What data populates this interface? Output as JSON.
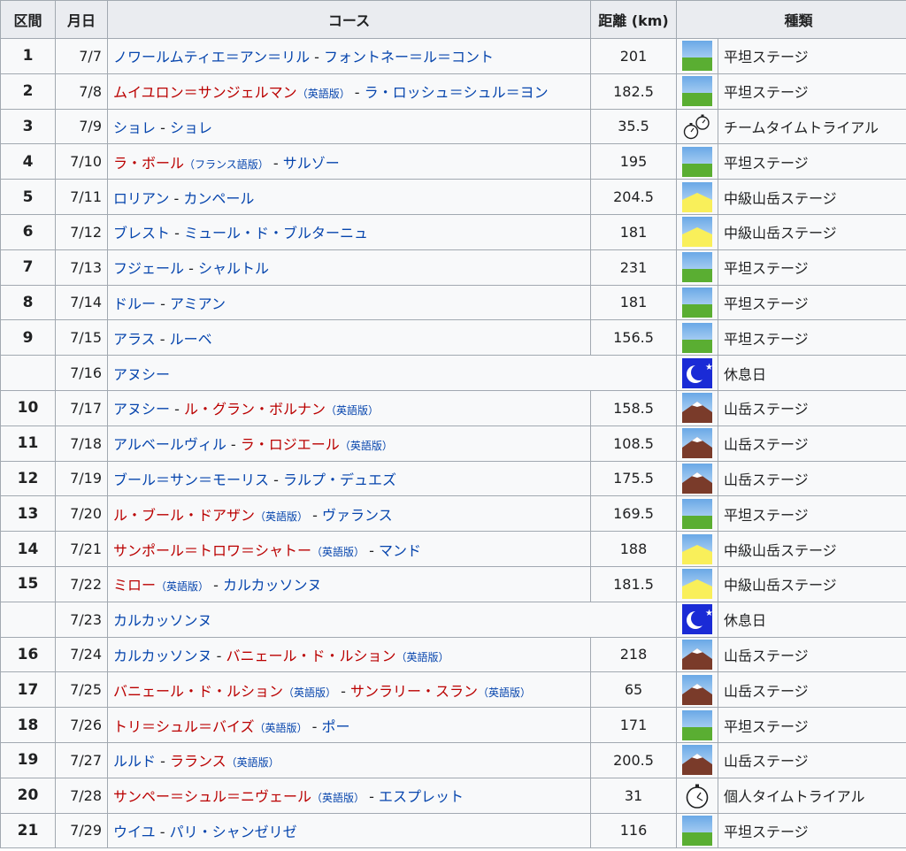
{
  "headers": [
    "区間",
    "月日",
    "コース",
    "距離 (km)",
    "種類"
  ],
  "rows": [
    {
      "stage": "1",
      "date": "7/7",
      "course": [
        {
          "t": "ノワールムティエ＝アン＝リル",
          "c": "blue"
        },
        {
          "t": " - ",
          "c": "sep"
        },
        {
          "t": "フォントネー＝ル＝コント",
          "c": "blue"
        }
      ],
      "dist": "201",
      "icon": "flat-stage-icon",
      "type": "平坦ステージ"
    },
    {
      "stage": "2",
      "date": "7/8",
      "course": [
        {
          "t": "ムイユロン＝サンジェルマン",
          "c": "red"
        },
        {
          "t": "（英語版）",
          "c": "small"
        },
        {
          "t": " - ",
          "c": "sep"
        },
        {
          "t": "ラ・ロッシュ＝シュル＝ヨン",
          "c": "blue"
        }
      ],
      "dist": "182.5",
      "icon": "flat-stage-icon",
      "type": "平坦ステージ"
    },
    {
      "stage": "3",
      "date": "7/9",
      "course": [
        {
          "t": "ショレ",
          "c": "blue"
        },
        {
          "t": " - ",
          "c": "sep"
        },
        {
          "t": "ショレ",
          "c": "blue"
        }
      ],
      "dist": "35.5",
      "icon": "team-time-trial-icon",
      "type": "チームタイムトライアル"
    },
    {
      "stage": "4",
      "date": "7/10",
      "course": [
        {
          "t": "ラ・ボール",
          "c": "red"
        },
        {
          "t": "（フランス語版）",
          "c": "small"
        },
        {
          "t": " - ",
          "c": "sep"
        },
        {
          "t": "サルゾー",
          "c": "blue"
        }
      ],
      "dist": "195",
      "icon": "flat-stage-icon",
      "type": "平坦ステージ"
    },
    {
      "stage": "5",
      "date": "7/11",
      "course": [
        {
          "t": "ロリアン",
          "c": "blue"
        },
        {
          "t": " - ",
          "c": "sep"
        },
        {
          "t": "カンペール",
          "c": "blue"
        }
      ],
      "dist": "204.5",
      "icon": "hilly-stage-icon",
      "type": "中級山岳ステージ"
    },
    {
      "stage": "6",
      "date": "7/12",
      "course": [
        {
          "t": "ブレスト",
          "c": "blue"
        },
        {
          "t": " - ",
          "c": "sep"
        },
        {
          "t": "ミュール・ド・ブルターニュ",
          "c": "blue"
        }
      ],
      "dist": "181",
      "icon": "hilly-stage-icon",
      "type": "中級山岳ステージ"
    },
    {
      "stage": "7",
      "date": "7/13",
      "course": [
        {
          "t": "フジェール",
          "c": "blue"
        },
        {
          "t": " - ",
          "c": "sep"
        },
        {
          "t": "シャルトル",
          "c": "blue"
        }
      ],
      "dist": "231",
      "icon": "flat-stage-icon",
      "type": "平坦ステージ"
    },
    {
      "stage": "8",
      "date": "7/14",
      "course": [
        {
          "t": "ドルー",
          "c": "blue"
        },
        {
          "t": " - ",
          "c": "sep"
        },
        {
          "t": "アミアン",
          "c": "blue"
        }
      ],
      "dist": "181",
      "icon": "flat-stage-icon",
      "type": "平坦ステージ"
    },
    {
      "stage": "9",
      "date": "7/15",
      "course": [
        {
          "t": "アラス",
          "c": "blue"
        },
        {
          "t": " - ",
          "c": "sep"
        },
        {
          "t": "ルーベ",
          "c": "blue"
        }
      ],
      "dist": "156.5",
      "icon": "flat-stage-icon",
      "type": "平坦ステージ"
    },
    {
      "stage": "",
      "date": "7/16",
      "course": [
        {
          "t": "アヌシー",
          "c": "blue"
        }
      ],
      "dist": null,
      "icon": "rest-day-icon",
      "type": "休息日"
    },
    {
      "stage": "10",
      "date": "7/17",
      "course": [
        {
          "t": "アヌシー",
          "c": "blue"
        },
        {
          "t": " - ",
          "c": "sep"
        },
        {
          "t": "ル・グラン・ボルナン",
          "c": "red"
        },
        {
          "t": "（英語版）",
          "c": "small"
        }
      ],
      "dist": "158.5",
      "icon": "mountain-stage-icon",
      "type": "山岳ステージ"
    },
    {
      "stage": "11",
      "date": "7/18",
      "course": [
        {
          "t": "アルベールヴィル",
          "c": "blue"
        },
        {
          "t": " - ",
          "c": "sep"
        },
        {
          "t": "ラ・ロジエール",
          "c": "red"
        },
        {
          "t": "（英語版）",
          "c": "small"
        }
      ],
      "dist": "108.5",
      "icon": "mountain-stage-icon",
      "type": "山岳ステージ"
    },
    {
      "stage": "12",
      "date": "7/19",
      "course": [
        {
          "t": "ブール＝サン＝モーリス",
          "c": "blue"
        },
        {
          "t": " - ",
          "c": "sep"
        },
        {
          "t": "ラルプ・デュエズ",
          "c": "blue"
        }
      ],
      "dist": "175.5",
      "icon": "mountain-stage-icon",
      "type": "山岳ステージ"
    },
    {
      "stage": "13",
      "date": "7/20",
      "course": [
        {
          "t": "ル・ブール・ドアザン",
          "c": "red"
        },
        {
          "t": "（英語版）",
          "c": "small"
        },
        {
          "t": " - ",
          "c": "sep"
        },
        {
          "t": "ヴァランス",
          "c": "blue"
        }
      ],
      "dist": "169.5",
      "icon": "flat-stage-icon",
      "type": "平坦ステージ"
    },
    {
      "stage": "14",
      "date": "7/21",
      "course": [
        {
          "t": "サンポール＝トロワ＝シャトー",
          "c": "red"
        },
        {
          "t": "（英語版）",
          "c": "small"
        },
        {
          "t": " - ",
          "c": "sep"
        },
        {
          "t": "マンド",
          "c": "blue"
        }
      ],
      "dist": "188",
      "icon": "hilly-stage-icon",
      "type": "中級山岳ステージ"
    },
    {
      "stage": "15",
      "date": "7/22",
      "course": [
        {
          "t": "ミロー",
          "c": "red"
        },
        {
          "t": "（英語版）",
          "c": "small"
        },
        {
          "t": " - ",
          "c": "sep"
        },
        {
          "t": "カルカッソンヌ",
          "c": "blue"
        }
      ],
      "dist": "181.5",
      "icon": "hilly-stage-icon",
      "type": "中級山岳ステージ"
    },
    {
      "stage": "",
      "date": "7/23",
      "course": [
        {
          "t": "カルカッソンヌ",
          "c": "blue"
        }
      ],
      "dist": null,
      "icon": "rest-day-icon",
      "type": "休息日"
    },
    {
      "stage": "16",
      "date": "7/24",
      "course": [
        {
          "t": "カルカッソンヌ",
          "c": "blue"
        },
        {
          "t": " - ",
          "c": "sep"
        },
        {
          "t": "バニェール・ド・ルション",
          "c": "red"
        },
        {
          "t": "（英語版）",
          "c": "small"
        }
      ],
      "dist": "218",
      "icon": "mountain-stage-icon",
      "type": "山岳ステージ"
    },
    {
      "stage": "17",
      "date": "7/25",
      "course": [
        {
          "t": "バニェール・ド・ルション",
          "c": "red"
        },
        {
          "t": "（英語版）",
          "c": "small"
        },
        {
          "t": " - ",
          "c": "sep"
        },
        {
          "t": "サンラリー・スラン",
          "c": "red"
        },
        {
          "t": "（英語版）",
          "c": "small"
        }
      ],
      "dist": "65",
      "icon": "mountain-stage-icon",
      "type": "山岳ステージ"
    },
    {
      "stage": "18",
      "date": "7/26",
      "course": [
        {
          "t": "トリ＝シュル＝バイズ",
          "c": "red"
        },
        {
          "t": "（英語版）",
          "c": "small"
        },
        {
          "t": " - ",
          "c": "sep"
        },
        {
          "t": "ポー",
          "c": "blue"
        }
      ],
      "dist": "171",
      "icon": "flat-stage-icon",
      "type": "平坦ステージ"
    },
    {
      "stage": "19",
      "date": "7/27",
      "course": [
        {
          "t": "ルルド",
          "c": "blue"
        },
        {
          "t": " - ",
          "c": "sep"
        },
        {
          "t": "ラランス",
          "c": "red"
        },
        {
          "t": "（英語版）",
          "c": "small"
        }
      ],
      "dist": "200.5",
      "icon": "mountain-stage-icon",
      "type": "山岳ステージ"
    },
    {
      "stage": "20",
      "date": "7/28",
      "course": [
        {
          "t": "サンペー＝シュル＝ニヴェール",
          "c": "red"
        },
        {
          "t": "（英語版）",
          "c": "small"
        },
        {
          "t": " - ",
          "c": "sep"
        },
        {
          "t": "エスプレット",
          "c": "blue"
        }
      ],
      "dist": "31",
      "icon": "time-trial-icon",
      "type": "個人タイムトライアル"
    },
    {
      "stage": "21",
      "date": "7/29",
      "course": [
        {
          "t": "ウイユ",
          "c": "blue"
        },
        {
          "t": " - ",
          "c": "sep"
        },
        {
          "t": "パリ・シャンゼリゼ",
          "c": "blue"
        }
      ],
      "dist": "116",
      "icon": "flat-stage-icon",
      "type": "平坦ステージ"
    }
  ],
  "colors": {
    "link": "#0645ad",
    "redlink": "#ba0000",
    "header_bg": "#eaecf0",
    "cell_bg": "#f8f9fa",
    "border": "#a2a9b1"
  }
}
